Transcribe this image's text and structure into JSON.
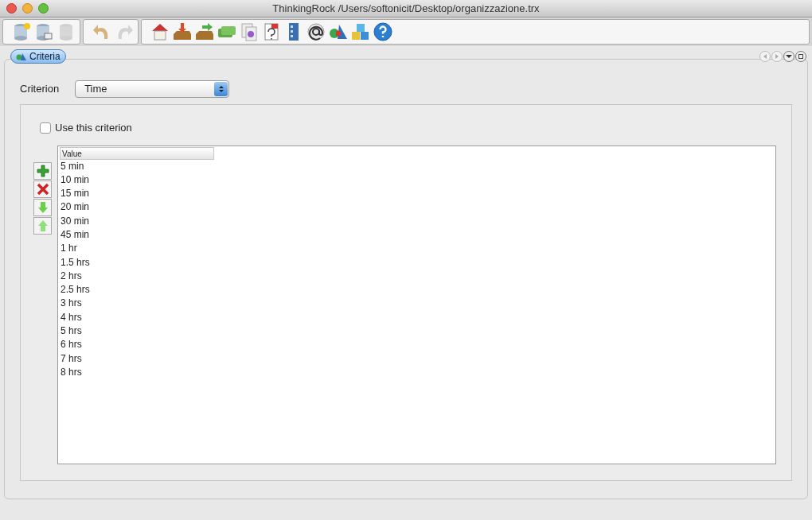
{
  "window": {
    "title": "ThinkingRock /Users/softonicit/Desktop/organizzazione.trx"
  },
  "toolbar": {
    "groups": [
      [
        {
          "disabled": false
        },
        {
          "disabled": false
        },
        {
          "disabled": true
        }
      ],
      [
        {
          "disabled": false
        },
        {
          "disabled": true
        }
      ],
      [
        {
          "disabled": false
        },
        {
          "disabled": false
        },
        {
          "disabled": false
        },
        {
          "disabled": false
        },
        {
          "disabled": false
        },
        {
          "disabled": false
        },
        {
          "disabled": false
        },
        {
          "disabled": false
        },
        {
          "disabled": false
        },
        {
          "disabled": false
        },
        {
          "disabled": false
        }
      ]
    ]
  },
  "tabs": [
    {
      "label": "Criteria",
      "selected": true
    }
  ],
  "criterion": {
    "label": "Criterion",
    "value": "Time"
  },
  "use_criterion": {
    "label": "Use this criterion",
    "checked": false
  },
  "table": {
    "columns": [
      "Value"
    ],
    "rows": [
      "5 min",
      "10 min",
      "15 min",
      "20 min",
      "30 min",
      "45 min",
      "1 hr",
      "1.5 hrs",
      "2 hrs",
      "2.5 hrs",
      "3 hrs",
      "4 hrs",
      "5 hrs",
      "6 hrs",
      "7 hrs",
      "8 hrs"
    ]
  }
}
